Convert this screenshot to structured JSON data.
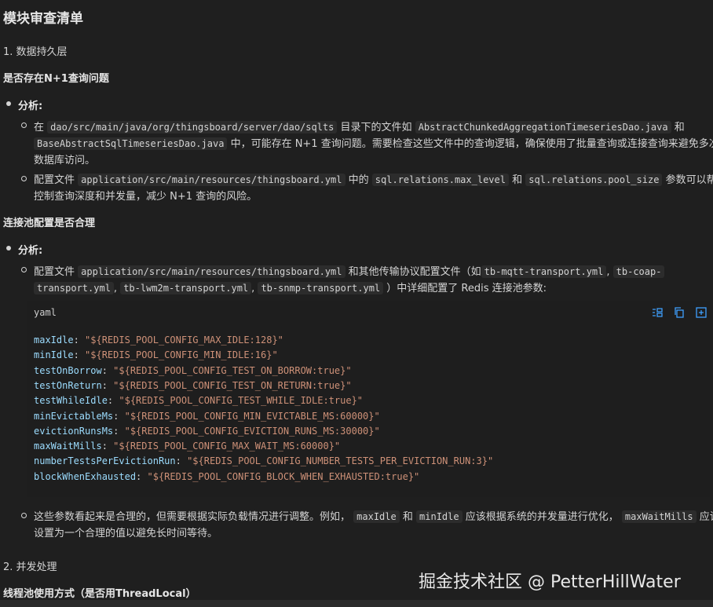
{
  "title": "模块审查清单",
  "section1": {
    "heading": "1. 数据持久层",
    "q1": "是否存在N+1查询问题",
    "analysis_label": "分析:",
    "item1": {
      "t1": "在",
      "c1": "dao/src/main/java/org/thingsboard/server/dao/sqlts",
      "t2": "目录下的文件如",
      "c2": "AbstractChunkedAggregationTimeseriesDao.java",
      "t3": "和",
      "c3": "BaseAbstractSqlTimeseriesDao.java",
      "t4": "中，可能存在 N+1 查询问题。需要检查这些文件中的查询逻辑，确保使用了批量查询或连接查询来避免多次",
      "t5": "数据库访问。"
    },
    "item2": {
      "t1": "配置文件",
      "c1": "application/src/main/resources/thingsboard.yml",
      "t2": "中的",
      "c2": "sql.relations.max_level",
      "t3": "和",
      "c3": "sql.relations.pool_size",
      "t4": "参数可以帮助",
      "t5": "控制查询深度和并发量，减少 N+1 查询的风险。"
    },
    "q2": "连接池配置是否合理",
    "analysis_label2": "分析:",
    "item3": {
      "t1": "配置文件",
      "c1": "application/src/main/resources/thingsboard.yml",
      "t2": "和其他传输协议配置文件（如",
      "c2": "tb-mqtt-transport.yml",
      "t3": ",",
      "c3": "tb-coap-",
      "c4": "transport.yml",
      "t4": ",",
      "c5": "tb-lwm2m-transport.yml",
      "t5": ",",
      "c6": "tb-snmp-transport.yml",
      "t6": "）中详细配置了 Redis 连接池参数:"
    },
    "code": {
      "lang": "yaml",
      "lines": [
        {
          "k": "maxIdle",
          "v": "\"${REDIS_POOL_CONFIG_MAX_IDLE:128}\""
        },
        {
          "k": "minIdle",
          "v": "\"${REDIS_POOL_CONFIG_MIN_IDLE:16}\""
        },
        {
          "k": "testOnBorrow",
          "v": "\"${REDIS_POOL_CONFIG_TEST_ON_BORROW:true}\""
        },
        {
          "k": "testOnReturn",
          "v": "\"${REDIS_POOL_CONFIG_TEST_ON_RETURN:true}\""
        },
        {
          "k": "testWhileIdle",
          "v": "\"${REDIS_POOL_CONFIG_TEST_WHILE_IDLE:true}\""
        },
        {
          "k": "minEvictableMs",
          "v": "\"${REDIS_POOL_CONFIG_MIN_EVICTABLE_MS:60000}\""
        },
        {
          "k": "evictionRunsMs",
          "v": "\"${REDIS_POOL_CONFIG_EVICTION_RUNS_MS:30000}\""
        },
        {
          "k": "maxWaitMills",
          "v": "\"${REDIS_POOL_CONFIG_MAX_WAIT_MS:60000}\""
        },
        {
          "k": "numberTestsPerEvictionRun",
          "v": "\"${REDIS_POOL_CONFIG_NUMBER_TESTS_PER_EVICTION_RUN:3}\""
        },
        {
          "k": "blockWhenExhausted",
          "v": "\"${REDIS_POOL_CONFIG_BLOCK_WHEN_EXHAUSTED:true}\""
        }
      ]
    },
    "item4": {
      "t1": "这些参数看起来是合理的，但需要根据实际负载情况进行调整。例如，",
      "c1": "maxIdle",
      "t2": "和",
      "c2": "minIdle",
      "t3": "应该根据系统的并发量进行优化，",
      "c3": "maxWaitMills",
      "t4": "应该",
      "t5": "设置为一个合理的值以避免长时间等待。"
    }
  },
  "section2": {
    "heading": "2. 并发处理",
    "q1": "线程池使用方式（是否用ThreadLocal）"
  },
  "watermark": "掘金技术社区 @ PetterHillWater",
  "colors": {
    "background": "#1f1f1f",
    "key": "#9cdcfe",
    "string": "#ce9178",
    "tool_icon": "#3fa0ff"
  }
}
